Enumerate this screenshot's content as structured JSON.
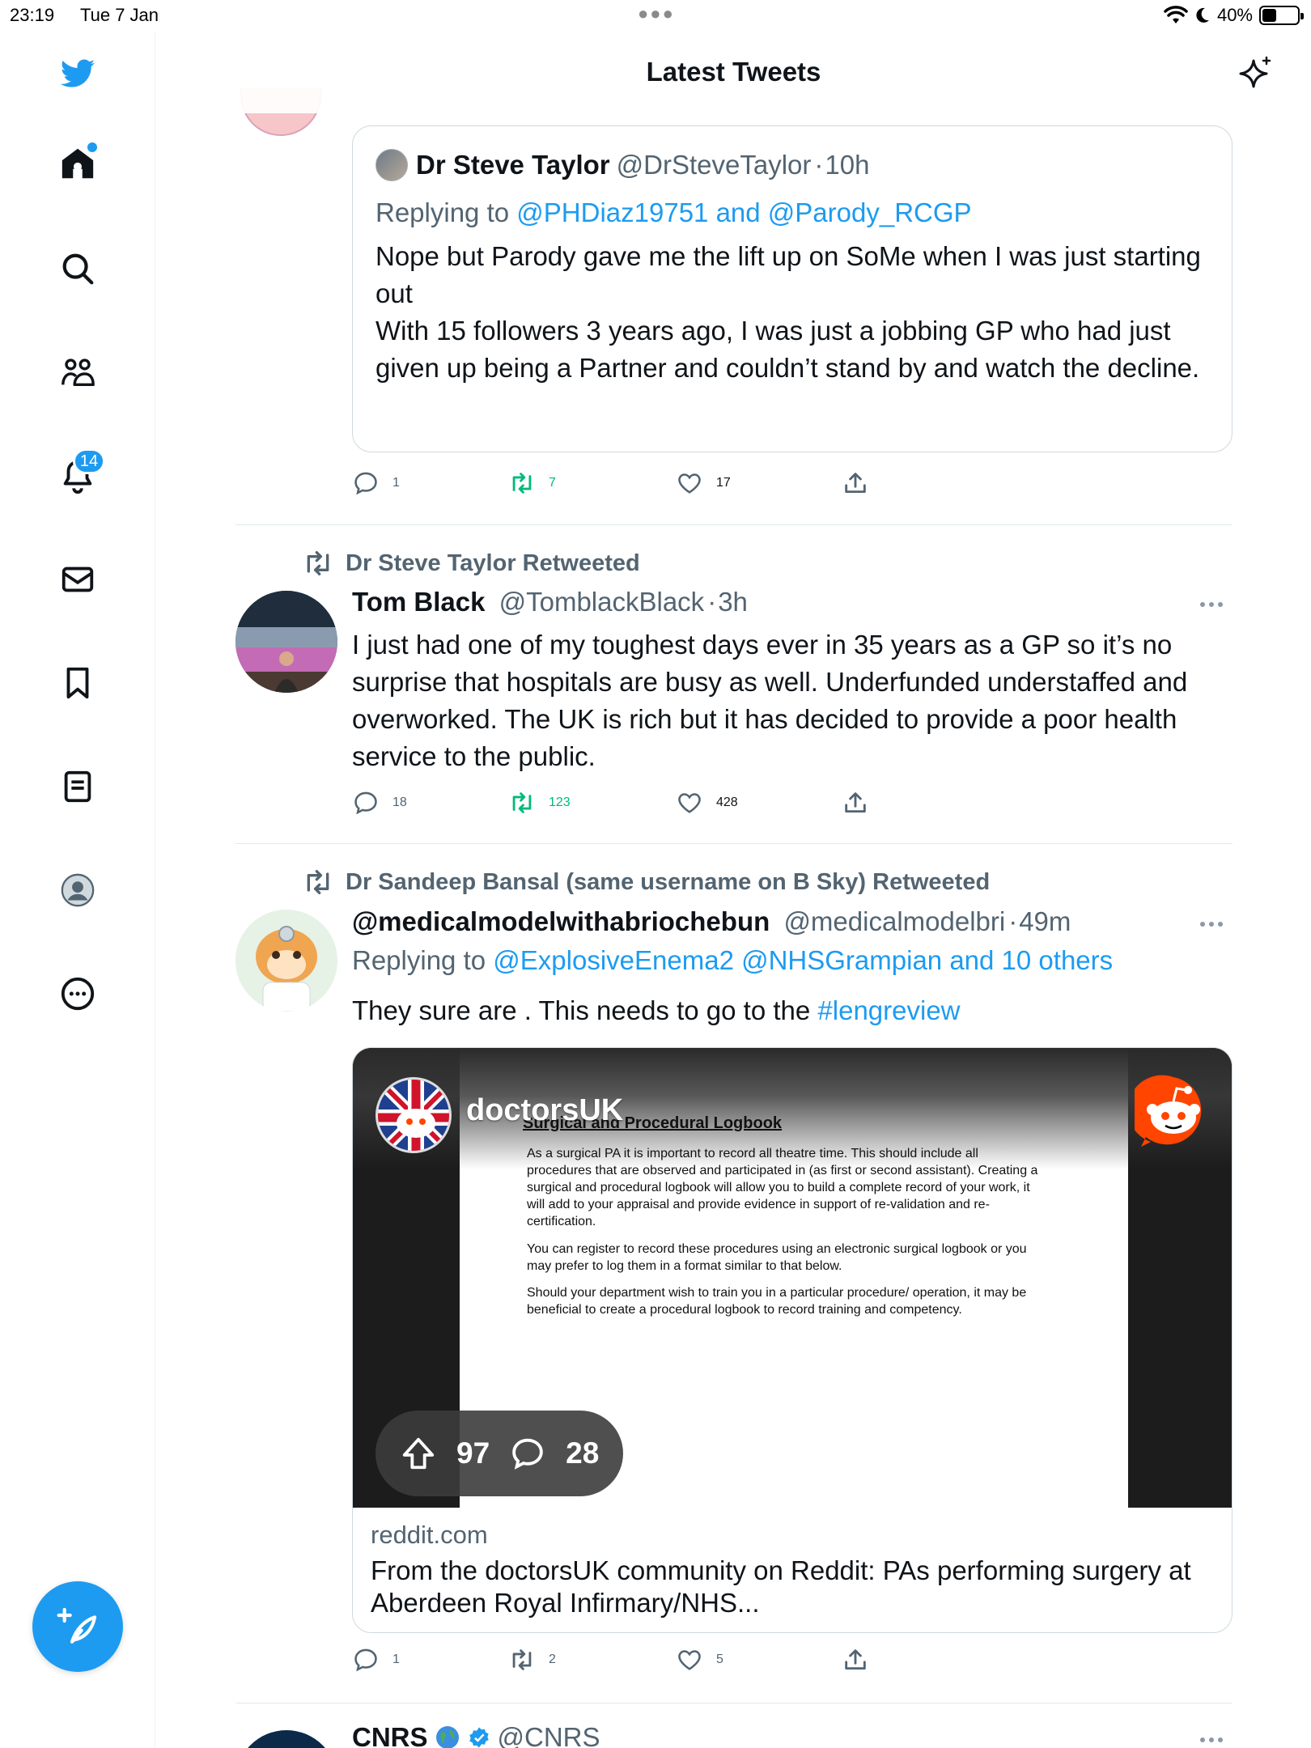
{
  "status_bar": {
    "time": "23:19",
    "date": "Tue 7 Jan",
    "battery": "40%",
    "battery_level": 0.4
  },
  "header": {
    "title": "Latest Tweets"
  },
  "nav": {
    "notifications_count": "14"
  },
  "quoted_tweet": {
    "author_name": "Dr Steve Taylor",
    "author_handle": "@DrSteveTaylor",
    "time": "10h",
    "replying_prefix": "Replying to",
    "replying_to": "@PHDiaz19751 and @Parody_RCGP",
    "text_line_1": "Nope but Parody gave me the lift up on SoMe when I was just starting out",
    "text_line_2": "With 15 followers 3 years ago, I was just a jobbing GP who had just given up being a Partner and couldn’t stand by and watch the decline."
  },
  "tweet1_actions": {
    "replies": "1",
    "retweets": "7",
    "likes": "17"
  },
  "tweet2": {
    "social_context": "Dr Steve Taylor Retweeted",
    "author_name": "Tom Black",
    "author_handle": "@TomblackBlack",
    "time": "3h",
    "text": "I just had one of my toughest days ever in 35 years as a GP so it’s no surprise that hospitals are busy as well. Underfunded understaffed and overworked. The UK is rich but it has decided to provide a poor health service to the public.",
    "replies": "18",
    "retweets": "123",
    "likes": "428"
  },
  "tweet3": {
    "social_context": "Dr Sandeep Bansal (same username on B Sky) Retweeted",
    "author_name": "@medicalmodelwithabriochebun",
    "author_handle": "@medicalmodelbri",
    "time": "49m",
    "replying_prefix": "Replying to",
    "replying_to": "@ExplosiveEnema2 @NHSGrampian and 10 others",
    "text": "They sure are . This needs to go to the",
    "hashtag": "#lengreview",
    "card": {
      "subreddit": "doctorsUK",
      "doc_title": "Surgical and Procedural Logbook",
      "doc_para_1": "As a surgical PA it is important to record all theatre time. This should include all procedures that are observed and participated in (as first or second assistant). Creating a surgical and procedural logbook will allow you to build a complete record of your work, it will add to your appraisal and provide evidence in support of re-validation and re-certification.",
      "doc_para_2": "You can register to record these procedures using an electronic surgical logbook or you may prefer to log them in a format similar to that below.",
      "doc_para_3": "Should your department wish to train you in a particular procedure/ operation, it may be beneficial to create a procedural logbook to record training and competency.",
      "upvotes": "97",
      "comments": "28",
      "domain": "reddit.com",
      "title": "From the doctorsUK community on Reddit: PAs performing surgery at Aberdeen Royal Infirmary/NHS..."
    },
    "replies": "1",
    "retweets": "2",
    "likes": "5"
  },
  "tweet4": {
    "author_name": "CNRS",
    "author_handle": "@CNRS"
  },
  "colors": {
    "accent": "#1d9bf0",
    "retweet_green": "#00ba7c",
    "secondary_text": "#536471"
  },
  "icons": [
    "twitter-logo-icon",
    "home-icon",
    "search-icon",
    "communities-icon",
    "bell-icon",
    "mail-icon",
    "bookmark-icon",
    "lists-icon",
    "profile-icon",
    "more-circle-icon",
    "compose-icon",
    "sparkle-icon",
    "reply-icon",
    "retweet-icon",
    "like-icon",
    "share-icon",
    "upvote-icon",
    "comment-bubble-icon",
    "reddit-logo-icon",
    "globe-icon",
    "verified-badge-icon"
  ]
}
